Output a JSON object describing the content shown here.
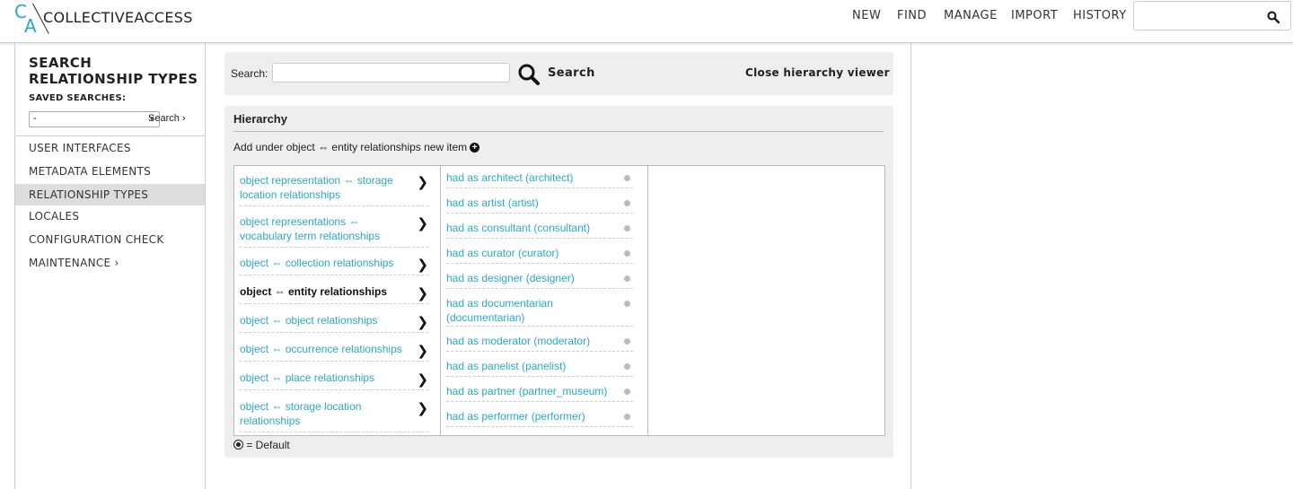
{
  "app": {
    "logo_c": "C",
    "logo_a": "A",
    "name": "COLLECTIVEACCESS"
  },
  "nav": [
    "NEW",
    "FIND",
    "MANAGE",
    "IMPORT",
    "HISTORY"
  ],
  "quick_search": {
    "value": "",
    "icon": "search-icon"
  },
  "sidebar": {
    "title": "SEARCH RELATIONSHIP TYPES",
    "saved_label": "SAVED SEARCHES:",
    "saved_value": "-",
    "saved_go": "Search ›",
    "items": [
      "USER INTERFACES",
      "METADATA ELEMENTS",
      "RELATIONSHIP TYPES",
      "LOCALES",
      "CONFIGURATION CHECK",
      "MAINTENANCE ›"
    ],
    "active_index": 2
  },
  "search": {
    "label": "Search:",
    "value": "",
    "button": "Search",
    "close": "Close hierarchy viewer"
  },
  "hierarchy": {
    "title": "Hierarchy",
    "add_text": "Add under object ⇔ entity relationships new item",
    "col1": [
      "object representation ⇔ storage location relationships",
      "object representations ⇔ vocabulary term relationships",
      "object ⇔ collection relationships",
      "object ⇔ entity relationships",
      "object ⇔ object relationships",
      "object ⇔ occurrence relationships",
      "object ⇔ place relationships",
      "object ⇔ storage location relationships"
    ],
    "col1_selected": 3,
    "col2": [
      "had as architect (architect)",
      "had as artist (artist)",
      "had as consultant (consultant)",
      "had as curator (curator)",
      "had as designer (designer)",
      "had as documentarian (documentarian)",
      "had as moderator (moderator)",
      "had as panelist (panelist)",
      "had as partner (partner_museum)",
      "had as performer (performer)"
    ],
    "legend": "= Default"
  },
  "colors": {
    "accent": "#29a9c4",
    "panel": "#eeeeee"
  }
}
